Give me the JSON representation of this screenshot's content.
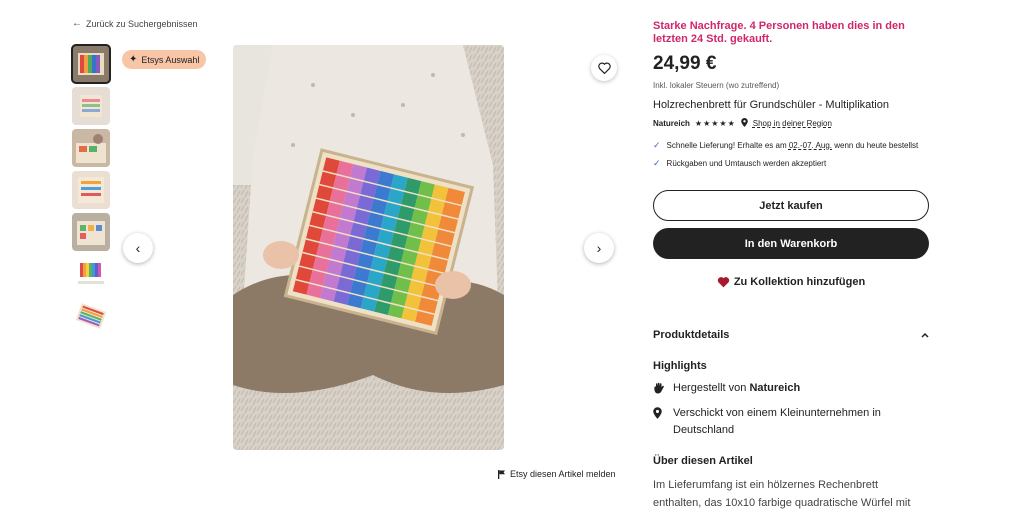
{
  "nav": {
    "back_label": "Zurück zu Suchergebnissen"
  },
  "gallery": {
    "badge_label": "Etsys Auswahl",
    "thumbnails": [
      "thumb-1",
      "thumb-2",
      "thumb-3",
      "thumb-4",
      "thumb-5",
      "thumb-6",
      "thumb-7"
    ],
    "report_label": "Etsy diesen Artikel melden"
  },
  "product": {
    "demand_text": "Starke Nachfrage. 4 Personen haben dies in den letzten 24 Std. gekauft.",
    "price": "24,99 €",
    "tax_note": "Inkl. lokaler Steuern (wo zutreffend)",
    "title": "Holzrechenbrett für Grundschüler - Multiplikation",
    "shop_name": "Natureich",
    "stars": "★★★★★",
    "region_label": "Shop in deiner Region",
    "shipping_prefix": "Schnelle Lieferung! Erhalte es am ",
    "shipping_date": "02.-07. Aug.",
    "shipping_suffix": " wenn du heute bestellst",
    "returns_text": "Rückgaben und Umtausch werden akzeptiert"
  },
  "actions": {
    "buy_now": "Jetzt kaufen",
    "add_to_cart": "In den Warenkorb",
    "add_to_collection": "Zu Kollektion hinzufügen"
  },
  "details": {
    "heading": "Produktdetails",
    "highlights_heading": "Highlights",
    "made_by_prefix": "Hergestellt von ",
    "made_by_shop": "Natureich",
    "shipped_by": "Verschickt von einem Kleinunternehmen in Deutschland",
    "about_heading": "Über diesen Artikel",
    "description": "Im Lieferumfang ist ein hölzernes Rechenbrett enthalten, das 10x10 farbige quadratische Würfel mit"
  },
  "colors": {
    "demand": "#d0276b",
    "button_dark": "#222222",
    "badge_bg": "#f9c5a7",
    "heart": "#a61a2e",
    "check": "#3b67c7"
  }
}
